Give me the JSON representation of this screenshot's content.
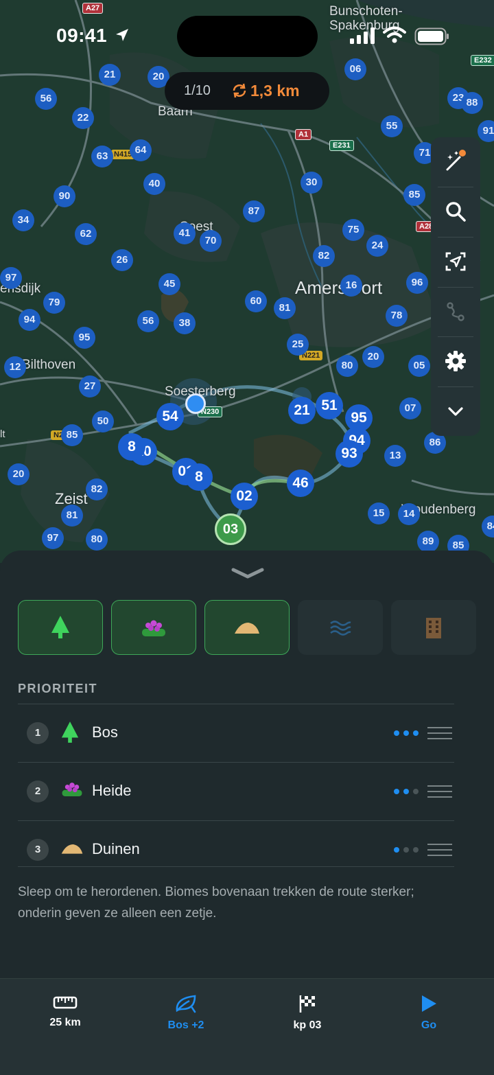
{
  "status": {
    "time": "09:41"
  },
  "route_pill": {
    "count": "1/10",
    "distance": "1,3 km"
  },
  "map": {
    "places": [
      {
        "id": "bunschoten",
        "label": "Bunschoten-\nSpakenburg"
      },
      {
        "id": "baarn",
        "label": "Baarn"
      },
      {
        "id": "soest",
        "label": "Soest"
      },
      {
        "id": "amersfoort",
        "label": "Amersfoort"
      },
      {
        "id": "soesterberg",
        "label": "Soesterberg"
      },
      {
        "id": "bilthoven",
        "label": "Bilthoven"
      },
      {
        "id": "zeist",
        "label": "Zeist"
      },
      {
        "id": "woudenberg",
        "label": "Woudenberg"
      },
      {
        "id": "ensdijk",
        "label": "ensdijk"
      },
      {
        "id": "it",
        "label": "lt"
      }
    ],
    "roads": [
      "A27",
      "A1",
      "E231",
      "E232",
      "N415",
      "N221",
      "N230",
      "A28",
      "N2"
    ],
    "checkpoints": [
      "21",
      "20",
      "06",
      "56",
      "22",
      "63",
      "64",
      "40",
      "90",
      "34",
      "62",
      "26",
      "97",
      "79",
      "94",
      "95",
      "12",
      "27",
      "50",
      "85",
      "20",
      "82",
      "81",
      "97",
      "80",
      "41",
      "70",
      "87",
      "30",
      "55",
      "75",
      "24",
      "82",
      "16",
      "96",
      "81",
      "60",
      "45",
      "56",
      "38",
      "25",
      "80",
      "20",
      "78",
      "05",
      "07",
      "86",
      "13",
      "15",
      "14",
      "89",
      "85",
      "23",
      "71",
      "85",
      "88",
      "91",
      "84"
    ],
    "route_checkpoints": [
      "54",
      "21",
      "51",
      "95",
      "94",
      "93",
      "46",
      "02",
      "01",
      "8",
      "10",
      "8"
    ],
    "finish_checkpoint": "03"
  },
  "toolbar": [
    "magic-wand-icon",
    "search-icon",
    "recenter-icon",
    "route-icon",
    "settings-icon",
    "chevron-down-icon"
  ],
  "biomes": [
    {
      "name": "Bos",
      "active": true
    },
    {
      "name": "Heide",
      "active": true
    },
    {
      "name": "Duinen",
      "active": true
    },
    {
      "name": "Water",
      "active": false
    },
    {
      "name": "Stad",
      "active": false
    }
  ],
  "priority": {
    "title": "PRIORITEIT",
    "items": [
      {
        "index": "1",
        "name": "Bos",
        "level": 3
      },
      {
        "index": "2",
        "name": "Heide",
        "level": 2
      },
      {
        "index": "3",
        "name": "Duinen",
        "level": 1
      }
    ],
    "helper": "Sleep om te herordenen. Biomes bovenaan trekken de route sterker; onderin geven ze alleen een zetje."
  },
  "tabs": [
    {
      "id": "distance",
      "label": "25 km"
    },
    {
      "id": "biomes",
      "label": "Bos +2"
    },
    {
      "id": "finish",
      "label": "kp 03"
    },
    {
      "id": "go",
      "label": "Go"
    }
  ],
  "colors": {
    "accent": "#1f8ef1",
    "orange": "#f28a3a",
    "green": "#3ea859",
    "map_bg": "#1e3a2f"
  }
}
